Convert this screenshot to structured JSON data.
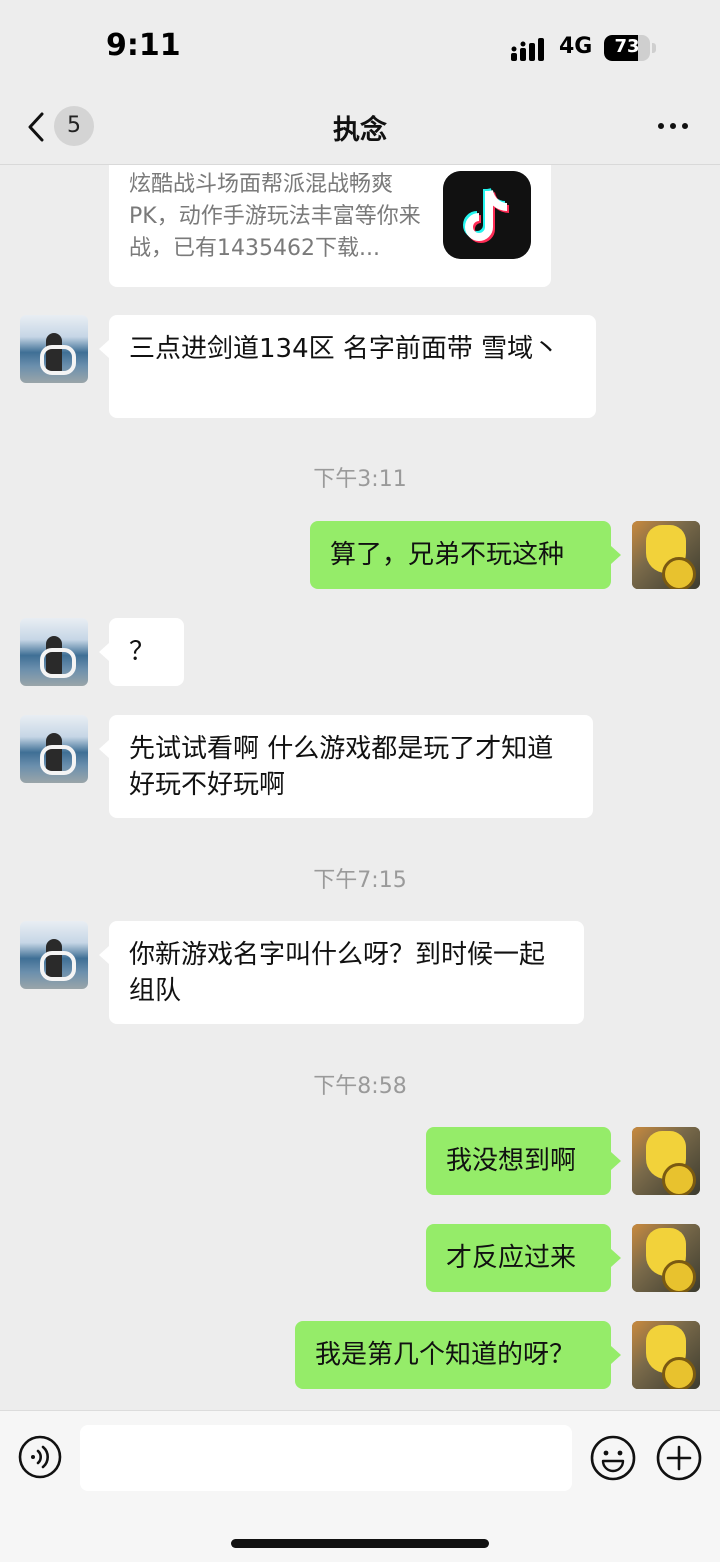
{
  "status_bar": {
    "time": "9:11",
    "network": "4G",
    "battery": "73",
    "battery_level": 0.73
  },
  "header": {
    "back_badge": "5",
    "title": "执念"
  },
  "shared_card": {
    "description": "炫酷战斗场面帮派混战畅爽PK，动作手游玩法丰富等你来战，已有1435462下载..."
  },
  "messages": {
    "m1": "三点进剑道134区 名字前面带 雪域丶",
    "ts1": "下午3:11",
    "m2": "算了，兄弟不玩这种",
    "m3": "？",
    "m4": "先试试看啊 什么游戏都是玩了才知道好玩不好玩啊",
    "ts2": "下午7:15",
    "m5": "你新游戏名字叫什么呀？到时候一起组队",
    "ts3": "下午8:58",
    "m6": "我没想到啊",
    "m7": "才反应过来",
    "m8": "我是第几个知道的呀？"
  },
  "icons": {
    "back": "chevron-left-icon",
    "more": "more-dots-icon",
    "voice": "voice-icon",
    "emoji": "emoji-icon",
    "plus": "plus-icon",
    "app": "tiktok-logo"
  },
  "colors": {
    "background": "#ededed",
    "my_bubble": "#95ec69",
    "other_bubble": "#ffffff",
    "timestamp": "#9a9a9a"
  }
}
